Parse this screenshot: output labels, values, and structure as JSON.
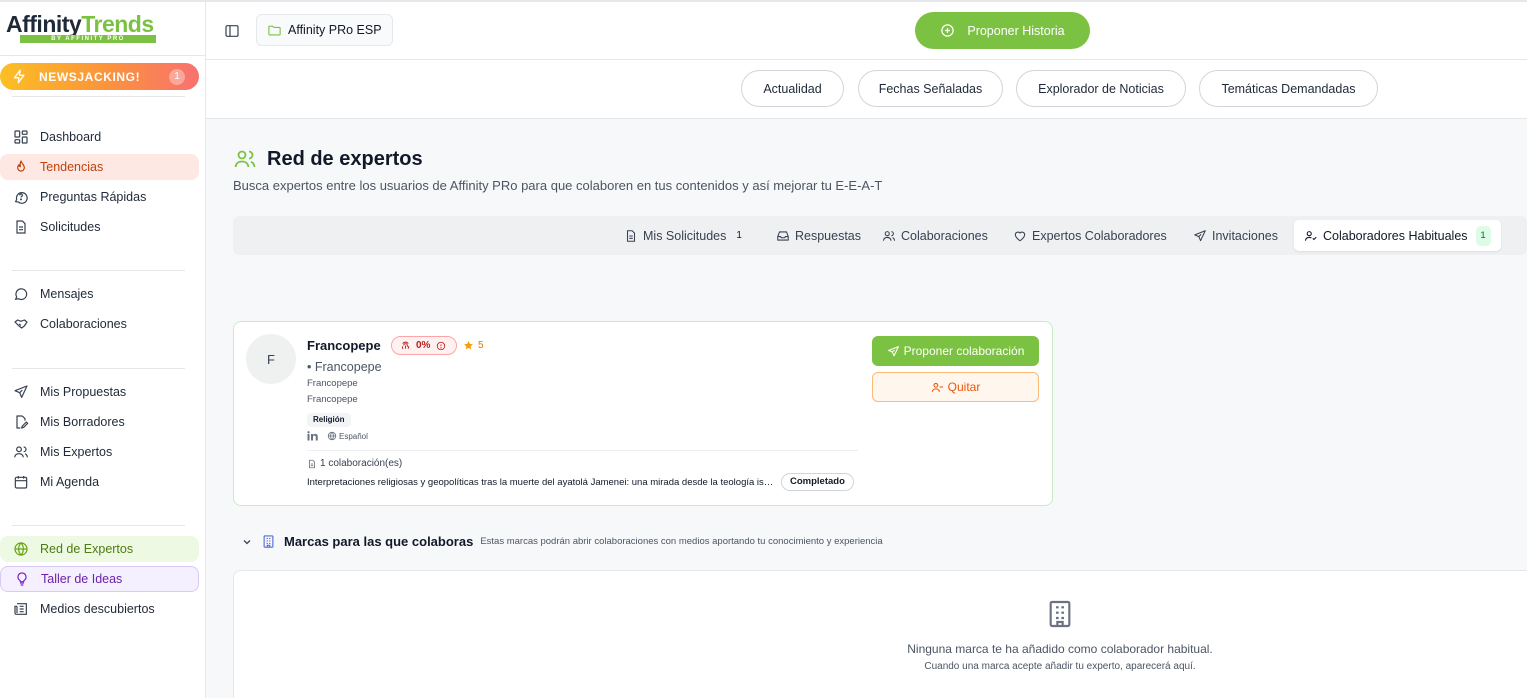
{
  "brand": {
    "logo_text_a": "Affinity",
    "logo_text_b": "Trends",
    "logo_sub": "BY AFFINITY PRO",
    "accent": "#7cc242"
  },
  "sidebar": {
    "newsjacking": {
      "label": "NEWSJACKING!",
      "count": "1",
      "icon": "bolt-icon"
    },
    "group1": [
      {
        "label": "Dashboard",
        "icon": "dashboard-icon"
      },
      {
        "label": "Tendencias",
        "icon": "flame-icon",
        "active": true
      },
      {
        "label": "Preguntas Rápidas",
        "icon": "question-icon"
      },
      {
        "label": "Solicitudes",
        "icon": "document-icon"
      }
    ],
    "group2": [
      {
        "label": "Mensajes",
        "icon": "chat-icon"
      },
      {
        "label": "Colaboraciones",
        "icon": "handshake-icon"
      }
    ],
    "group3": [
      {
        "label": "Mis Propuestas",
        "icon": "send-icon"
      },
      {
        "label": "Mis Borradores",
        "icon": "edit-doc-icon"
      },
      {
        "label": "Mis Expertos",
        "icon": "users-icon"
      },
      {
        "label": "Mi Agenda",
        "icon": "calendar-icon"
      }
    ],
    "group4": [
      {
        "label": "Red de Expertos",
        "icon": "globe-icon",
        "active": true
      },
      {
        "label": "Taller de Ideas",
        "icon": "lightbulb-icon"
      },
      {
        "label": "Medios descubiertos",
        "icon": "newspaper-icon"
      }
    ]
  },
  "header": {
    "workspace": "Affinity PRo ESP",
    "propose_label": "Proponer Historia"
  },
  "nav": {
    "pills": [
      "Actualidad",
      "Fechas Señaladas",
      "Explorador de Noticias",
      "Temáticas Demandadas"
    ]
  },
  "main": {
    "title": "Red de expertos",
    "subtitle": "Busca expertos entre los usuarios de Affinity PRo para que colaboren en tus contenidos y así mejorar tu E-E-A-T",
    "tabs": [
      {
        "label": "Mis Solicitudes",
        "count": "1",
        "icon": "document-icon"
      },
      {
        "label": "Respuestas",
        "icon": "inbox-icon"
      },
      {
        "label": "Colaboraciones",
        "icon": "users-icon"
      },
      {
        "label": "Expertos Colaboradores",
        "icon": "heart-icon"
      },
      {
        "label": "Invitaciones",
        "icon": "send-icon"
      },
      {
        "label": "Colaboradores Habituales",
        "count": "1",
        "icon": "user-check-icon",
        "active": true
      }
    ]
  },
  "expert": {
    "avatar": "F",
    "name": "Francopepe",
    "score": "0%",
    "rating": "5",
    "handle": "• Francopepe",
    "line1": "Francopepe",
    "line2": "Francopepe",
    "tag": "Religión",
    "language": "Español",
    "collab_count": "1 colaboración(es)",
    "collab_title": "Interpretaciones religiosas y geopolíticas tras la muerte del ayatolá Jamenei: una mirada desde la teología islámica y las",
    "collab_status": "Completado",
    "propose_label": "Proponer colaboración",
    "remove_label": "Quitar"
  },
  "marcas": {
    "title": "Marcas para las que colaboras",
    "description": "Estas marcas podrán abrir colaboraciones con medios aportando tu conocimiento y experiencia",
    "empty_title": "Ninguna marca te ha añadido como colaborador habitual.",
    "empty_sub": "Cuando una marca acepte añadir tu experto, aparecerá aquí."
  }
}
